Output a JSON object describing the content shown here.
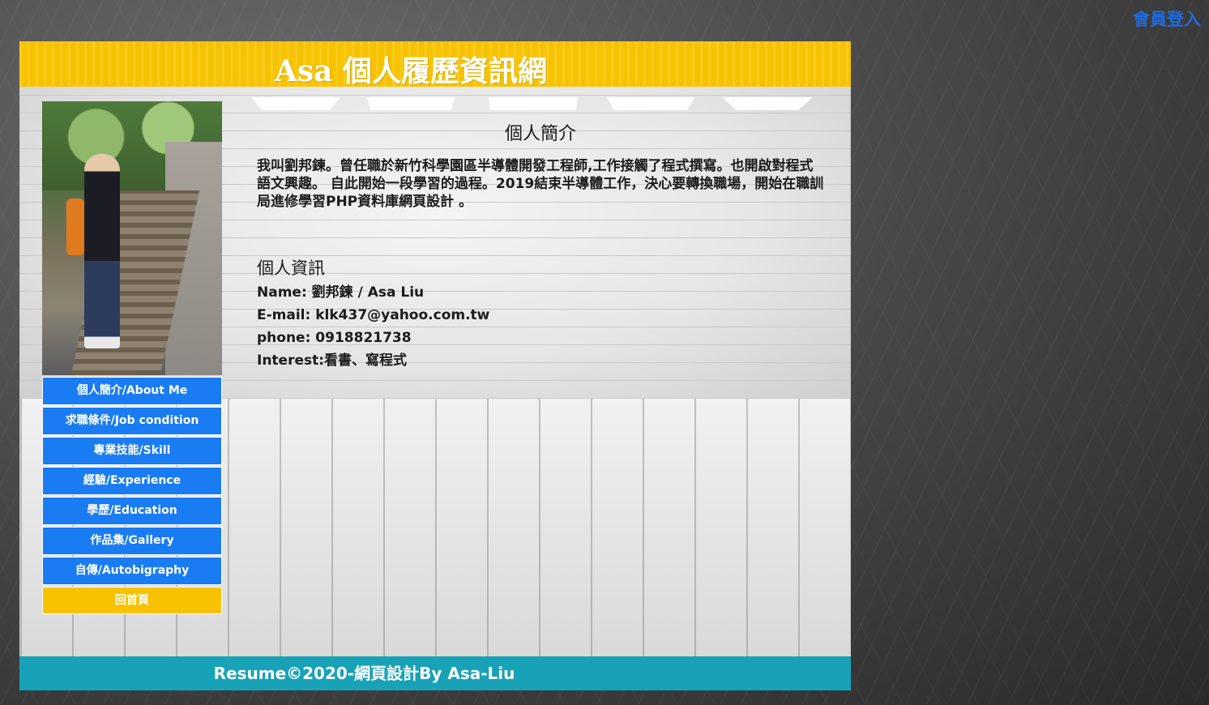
{
  "top_link": {
    "login_label": "會員登入"
  },
  "header": {
    "title": "Asa 個人履歷資訊網"
  },
  "sidebar": {
    "nav": [
      {
        "label": "個人簡介/About Me"
      },
      {
        "label": "求職條件/Job condition"
      },
      {
        "label": "專業技能/Skill"
      },
      {
        "label": "經驗/Experience"
      },
      {
        "label": "學歷/Education"
      },
      {
        "label": "作品集/Gallery"
      },
      {
        "label": "自傳/Autobigraphy"
      }
    ],
    "home_label": "回首頁"
  },
  "about": {
    "heading": "個人簡介",
    "text": "我叫劉邦鍊。曾任職於新竹科學園區半導體開發工程師,工作接觸了程式撰寫。也開啟對程式語文興趣。 自此開始一段學習的過程。2019結束半導體工作，決心要轉換職場，開始在職訓局進修學習PHP資料庫網頁設計 。"
  },
  "info": {
    "heading": "個人資訊",
    "name": "Name: 劉邦鍊 / Asa Liu",
    "email": "E-mail: klk437@yahoo.com.tw",
    "phone": "phone: 0918821738",
    "interest": "Interest:看書、寫程式"
  },
  "footer": {
    "text": "Resume©2020-網頁設計By Asa-Liu"
  },
  "colors": {
    "header_bg": "#f7c300",
    "nav_bg": "#1a7cf2",
    "home_bg": "#f7c300",
    "footer_bg": "#18a2b8",
    "login_link": "#1e6be0"
  }
}
